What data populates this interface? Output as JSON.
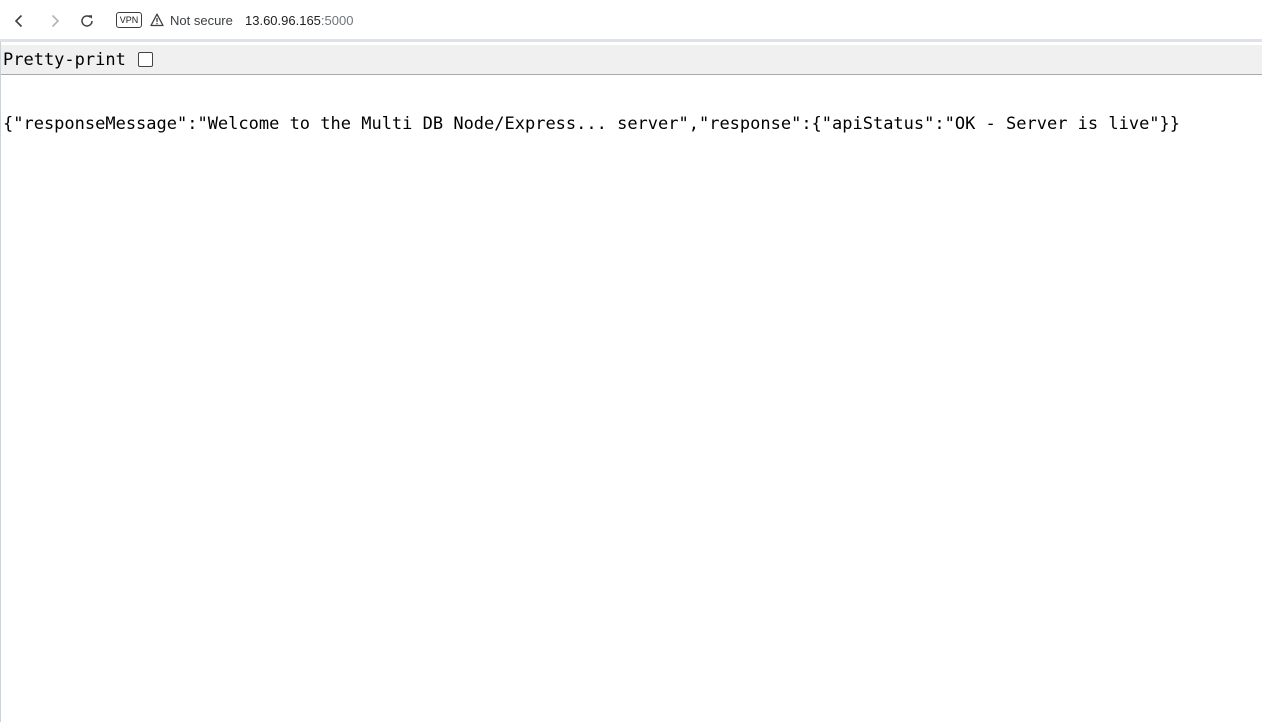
{
  "browser": {
    "back_icon": "chevron-left-icon",
    "forward_icon": "chevron-right-icon",
    "reload_icon": "reload-icon",
    "vpn_label": "VPN",
    "security_icon": "warning-triangle-icon",
    "security_text": "Not secure",
    "url_host": "13.60.96.165",
    "url_port": ":5000"
  },
  "viewer": {
    "pretty_print_label": "Pretty-print",
    "pretty_print_checked": false,
    "json_text": "{\"responseMessage\":\"Welcome to the Multi DB Node/Express... server\",\"response\":{\"apiStatus\":\"OK - Server is live\"}}"
  },
  "colors": {
    "chrome_bg": "#ffffff",
    "toolbar_bar_bg": "#f0f0f0",
    "text": "#000000"
  }
}
